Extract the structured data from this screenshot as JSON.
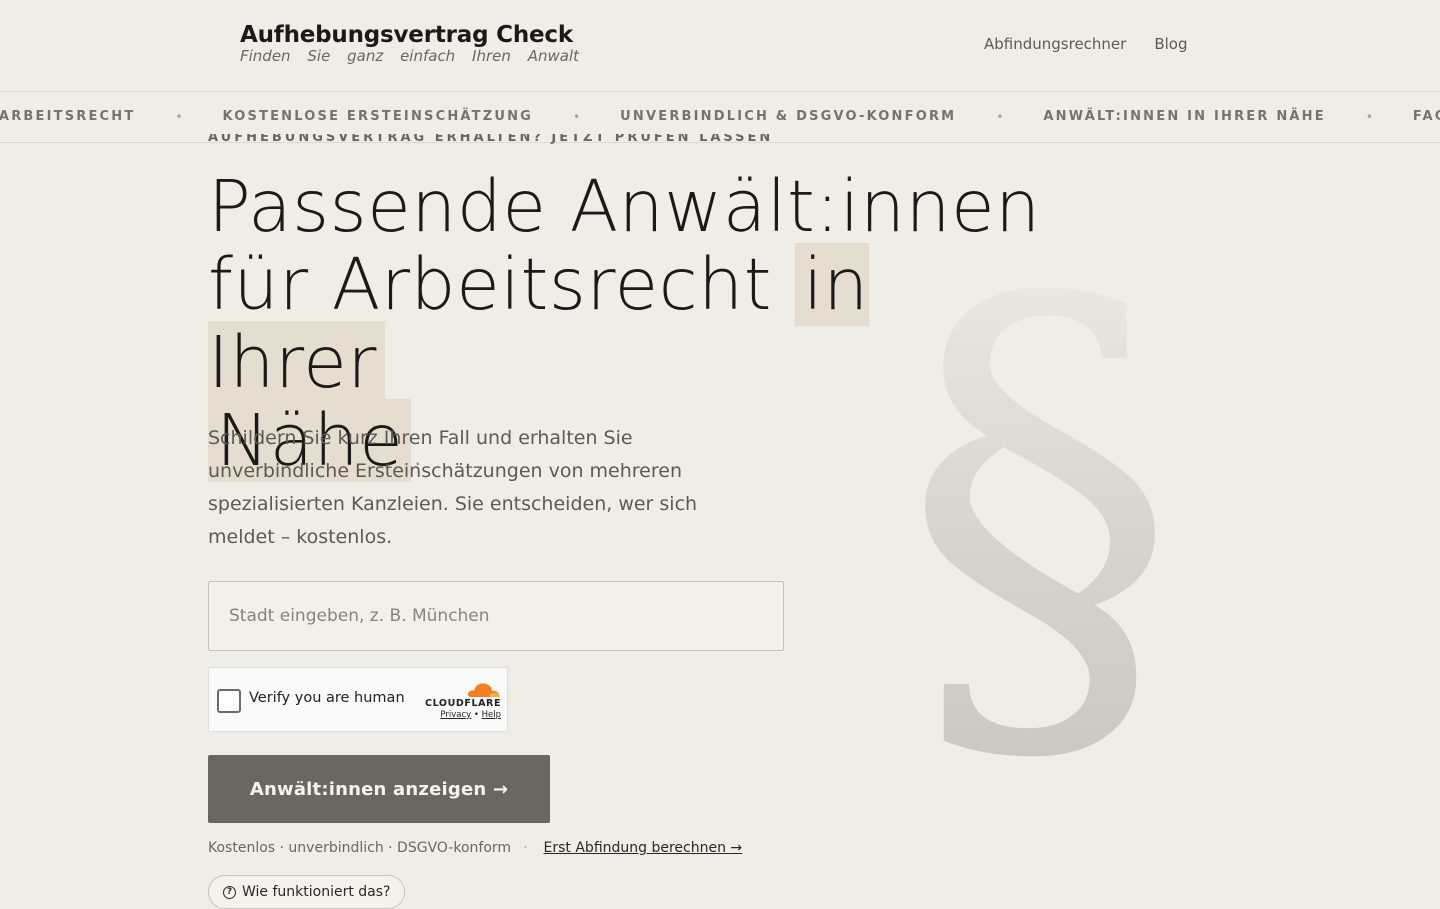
{
  "header": {
    "brand_title": "Aufhebungsvertrag Check",
    "tagline_words": [
      "Finden",
      "Sie",
      "ganz",
      "einfach",
      "Ihren",
      "Anwalt"
    ],
    "nav": [
      {
        "label": "Abfindungsrechner"
      },
      {
        "label": "Blog"
      }
    ]
  },
  "ticker": {
    "items": [
      "r Arbeitsrecht",
      "Kostenlose Ersteinschätzung",
      "Unverbindlich & DSGVO-konform",
      "Anwält:innen in Ihrer Nähe",
      "Fachanwä"
    ],
    "separator": "•"
  },
  "hero": {
    "eyebrow": "Aufhebungsvertrag erhalten? Jetzt prüfen lassen",
    "title_part1": "Passende Anwält:innen für Arbeitsrecht ",
    "title_highlight1": "in Ihrer",
    "title_highlight2": "Nähe",
    "title_end": ".",
    "section_symbol": "§",
    "lede": "Schildern Sie kurz Ihren Fall und erhalten Sie unverbindliche Ersteinschätzungen von mehreren spezialisierten Kanzleien. Sie entscheiden, wer sich meldet – kostenlos."
  },
  "form": {
    "city_placeholder": "Stadt eingeben, z. B. München",
    "city_value": "",
    "captcha_label": "Verify you are human",
    "captcha_brand": "CLOUDFLARE",
    "captcha_privacy": "Privacy",
    "captcha_dot": "•",
    "captcha_help": "Help",
    "submit_label": "Anwält:innen anzeigen →"
  },
  "footnote": {
    "text": "Kostenlos · unverbindlich · DSGVO-konform",
    "separator": "·",
    "link": "Erst Abfindung berechnen →"
  },
  "how_button": {
    "icon": "?",
    "label": "Wie funktioniert das?"
  },
  "colors": {
    "background": "#efede7",
    "highlight": "#e4ddd0",
    "button": "#6a6762",
    "cloudflare_orange": "#f38020"
  }
}
